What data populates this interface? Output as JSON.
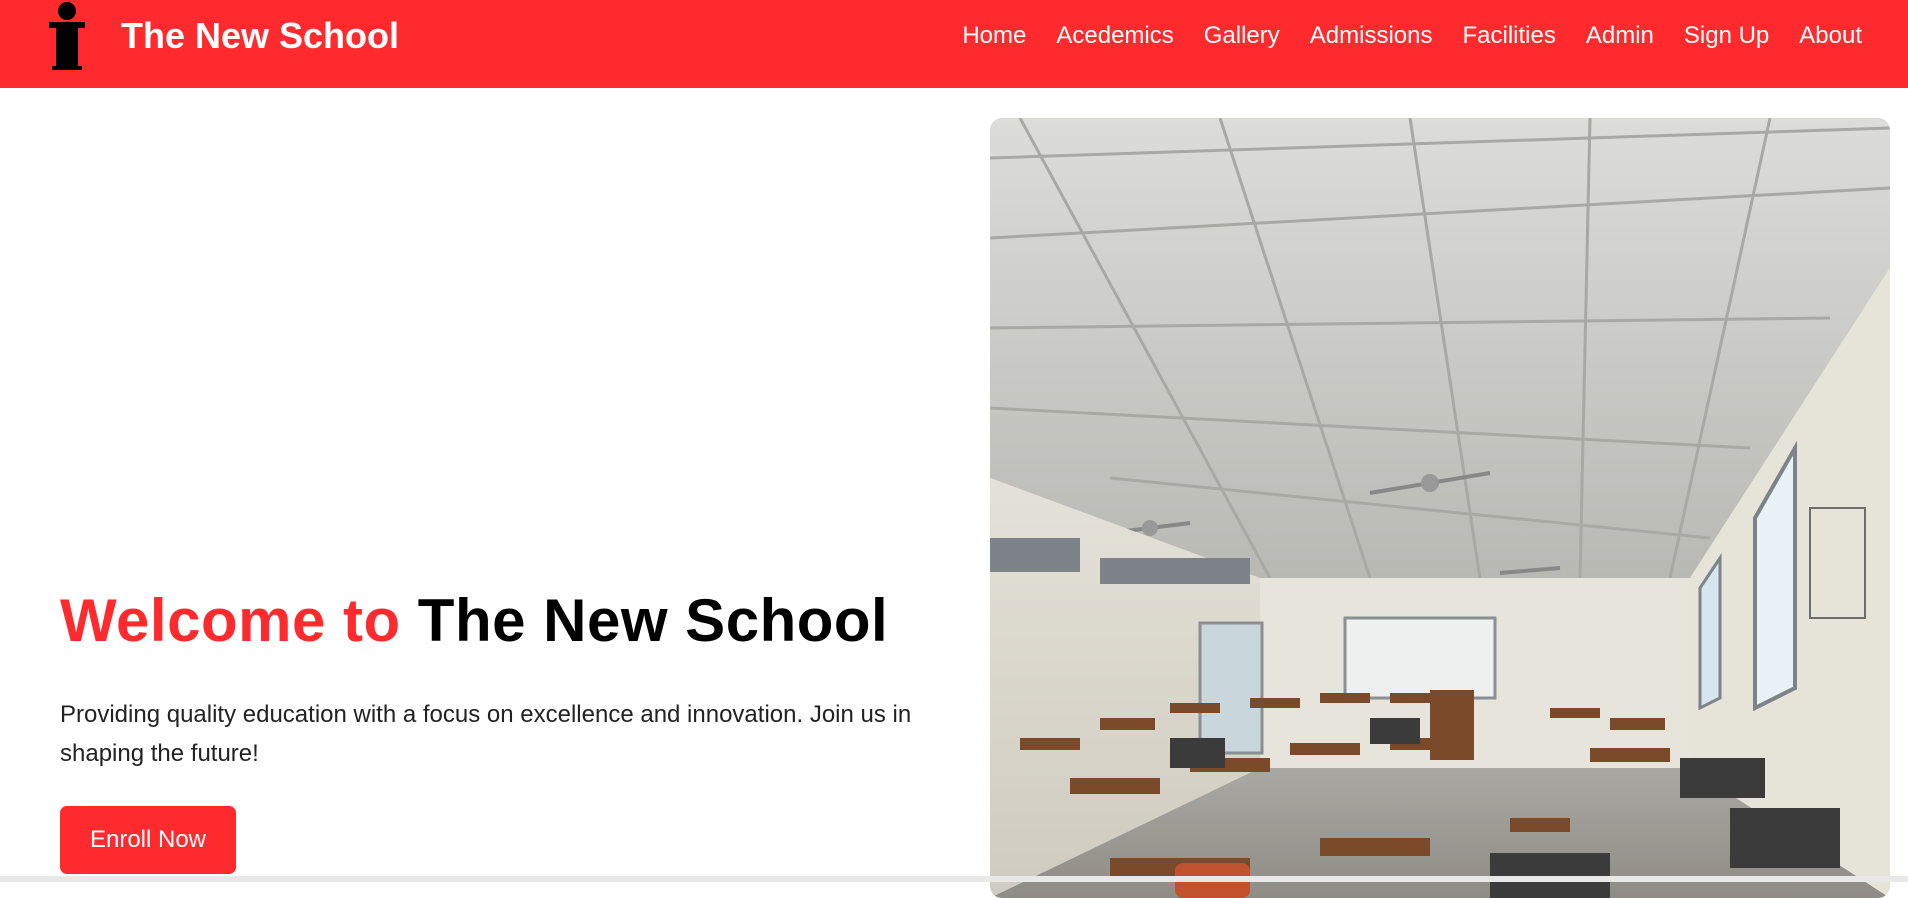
{
  "brand": {
    "name": "The New School",
    "icon": "podium-icon"
  },
  "nav": {
    "links": [
      "Home",
      "Acedemics",
      "Gallery",
      "Admissions",
      "Facilities",
      "Admin",
      "Sign Up",
      "About"
    ]
  },
  "hero": {
    "title_accent": "Welcome to",
    "title_main": "The New School",
    "description": "Providing quality education with a focus on excellence and innovation. Join us in shaping the future!",
    "cta_label": "Enroll Now",
    "image_subject": "classroom-photo"
  },
  "colors": {
    "brand_red": "#ff2a2d",
    "text_dark": "#000000",
    "text_body": "#222222"
  }
}
